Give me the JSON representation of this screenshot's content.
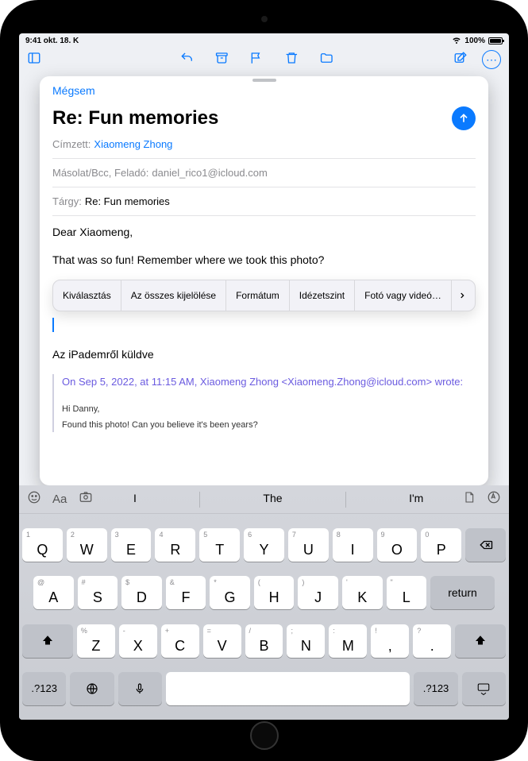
{
  "statusbar": {
    "time": "9:41  okt. 18. K",
    "battery": "100%"
  },
  "sheet": {
    "cancel": "Mégsem",
    "title": "Re: Fun memories",
    "to_label": "Címzett:",
    "to_value": "Xiaomeng Zhong",
    "ccbcc_label": "Másolat/Bcc, Feladó:",
    "ccbcc_value": "daniel_rico1@icloud.com",
    "subject_label": "Tárgy:",
    "subject_value": "Re: Fun memories"
  },
  "body": {
    "line1": "Dear Xiaomeng,",
    "line2": "That was so fun! Remember where we took this photo?",
    "signature": "Az iPademről küldve",
    "quote_header": "On Sep 5, 2022, at 11:15 AM, Xiaomeng Zhong <Xiaomeng.Zhong@icloud.com> wrote:",
    "quote_l1": "Hi Danny,",
    "quote_l2": "Found this photo! Can you believe it's been years?"
  },
  "context": {
    "select": "Kiválasztás",
    "selectall": "Az összes kijelölése",
    "format": "Formátum",
    "quote": "Idézetszint",
    "photo": "Fotó vagy videó…"
  },
  "kb": {
    "sugg1": "I",
    "sugg2": "The",
    "sugg3": "I'm",
    "return": "return",
    "numkey": ".?123",
    "row1": [
      {
        "main": "Q",
        "mini": "1"
      },
      {
        "main": "W",
        "mini": "2"
      },
      {
        "main": "E",
        "mini": "3"
      },
      {
        "main": "R",
        "mini": "4"
      },
      {
        "main": "T",
        "mini": "5"
      },
      {
        "main": "Y",
        "mini": "6"
      },
      {
        "main": "U",
        "mini": "7"
      },
      {
        "main": "I",
        "mini": "8"
      },
      {
        "main": "O",
        "mini": "9"
      },
      {
        "main": "P",
        "mini": "0"
      }
    ],
    "row2": [
      {
        "main": "A",
        "mini": "@"
      },
      {
        "main": "S",
        "mini": "#"
      },
      {
        "main": "D",
        "mini": "$"
      },
      {
        "main": "F",
        "mini": "&"
      },
      {
        "main": "G",
        "mini": "*"
      },
      {
        "main": "H",
        "mini": "("
      },
      {
        "main": "J",
        "mini": ")"
      },
      {
        "main": "K",
        "mini": "'"
      },
      {
        "main": "L",
        "mini": "\""
      }
    ],
    "row3": [
      {
        "main": "Z",
        "mini": "%"
      },
      {
        "main": "X",
        "mini": "-"
      },
      {
        "main": "C",
        "mini": "+"
      },
      {
        "main": "V",
        "mini": "="
      },
      {
        "main": "B",
        "mini": "/"
      },
      {
        "main": "N",
        "mini": ";"
      },
      {
        "main": "M",
        "mini": ":"
      },
      {
        "main": ",",
        "mini": "!"
      },
      {
        "main": ".",
        "mini": "?"
      }
    ]
  }
}
